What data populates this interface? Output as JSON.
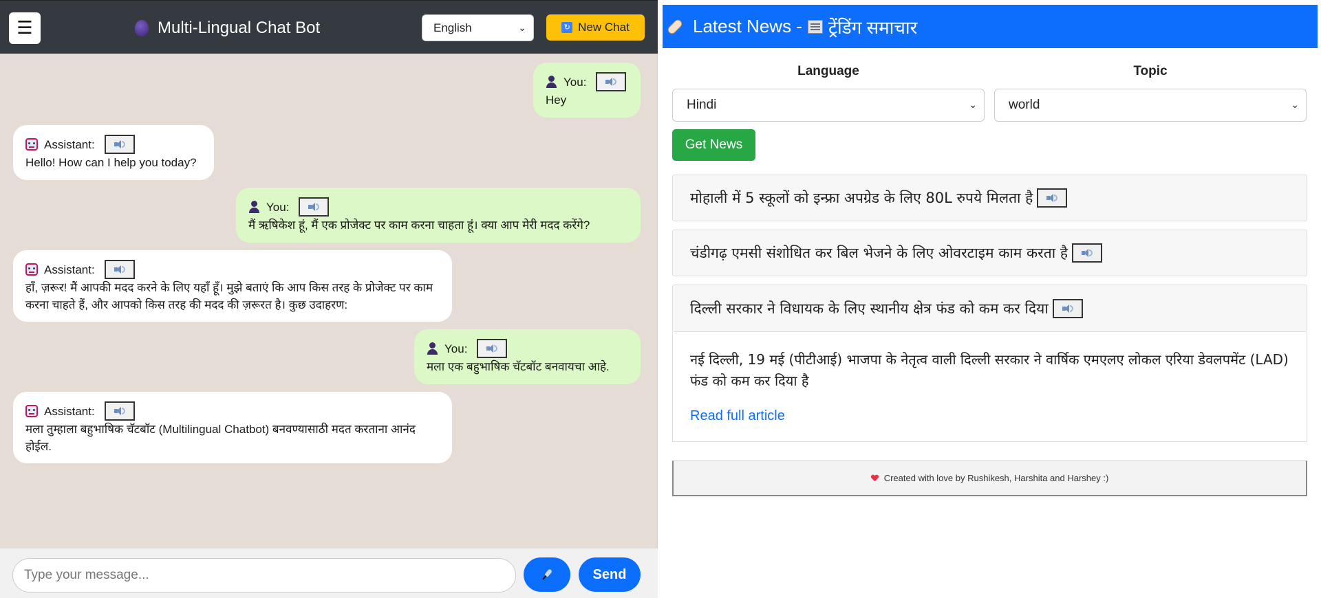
{
  "chat": {
    "title": "Multi-Lingual Chat Bot",
    "menu_label": "☰",
    "language_selected": "English",
    "new_chat_label": "New Chat",
    "messages": [
      {
        "role": "user",
        "sender": "You:",
        "text": "Hey"
      },
      {
        "role": "bot",
        "sender": "Assistant:",
        "text": "Hello! How can I help you today?"
      },
      {
        "role": "user",
        "sender": "You:",
        "text": "मैं ऋषिकेश हूं, मैं एक प्रोजेक्ट पर काम करना चाहता हूं। क्या आप मेरी मदद करेंगे?"
      },
      {
        "role": "bot",
        "sender": "Assistant:",
        "text": "हाँ, ज़रूर! मैं आपकी मदद करने के लिए यहाँ हूँ। मुझे बताएं कि आप किस तरह के प्रोजेक्ट पर काम करना चाहते हैं, और आपको किस तरह की मदद की ज़रूरत है। कुछ उदाहरण:"
      },
      {
        "role": "user",
        "sender": "You:",
        "text": "मला एक बहुभाषिक चॅटबॉट बनवायचा आहे."
      },
      {
        "role": "bot",
        "sender": "Assistant:",
        "text": "मला तुम्हाला बहुभाषिक चॅटबॉट (Multilingual Chatbot) बनवण्यासाठी मदत करताना आनंद होईल."
      }
    ],
    "input_placeholder": "Type your message...",
    "send_label": "Send"
  },
  "news": {
    "title_prefix": "Latest News - ",
    "title_suffix": "ट्रेंडिंग समाचार",
    "language_label": "Language",
    "topic_label": "Topic",
    "language_selected": "Hindi",
    "topic_selected": "world",
    "get_news_label": "Get News",
    "headlines": [
      "मोहाली में 5 स्कूलों को इन्फ्रा अपग्रेड के लिए 80L रुपये मिलता है",
      "चंडीगढ़ एमसी संशोधित कर बिल भेजने के लिए ओवरटाइम काम करता है",
      "दिल्ली सरकार ने विधायक के लिए स्थानीय क्षेत्र फंड को कम कर दिया"
    ],
    "expanded_summary": "नई दिल्ली, 19 मई (पीटीआई) भाजपा के नेतृत्व वाली दिल्ली सरकार ने वार्षिक एमएलए लोकल एरिया डेवलपमेंट (LAD) फंड को कम कर दिया है",
    "read_more_label": "Read full article",
    "footer_text": "Created with love by Rushikesh, Harshita and Harshey :)"
  },
  "colors": {
    "chat_header": "#343a40",
    "chat_bg": "#e5ddd5",
    "user_bubble": "#dcf8c6",
    "new_chat_btn": "#ffc107",
    "primary": "#0d6efd",
    "get_news_btn": "#28a745"
  }
}
